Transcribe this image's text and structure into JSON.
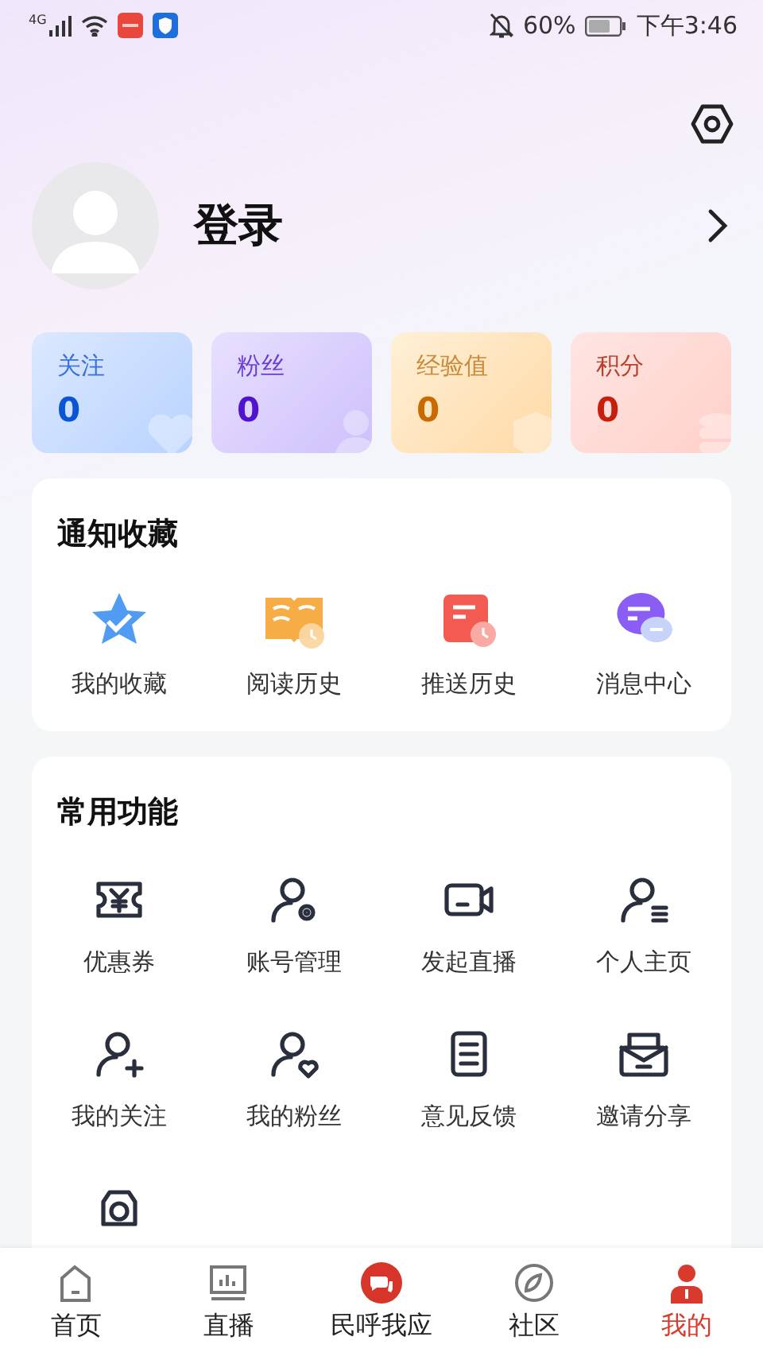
{
  "status_bar": {
    "network": "4G",
    "battery_percent": "60%",
    "time": "下午3:46"
  },
  "profile": {
    "name": "登录"
  },
  "stats": [
    {
      "label": "关注",
      "value": "0",
      "kind": "follow",
      "color": "#0a55d6"
    },
    {
      "label": "粉丝",
      "value": "0",
      "kind": "fans",
      "color": "#5014d0"
    },
    {
      "label": "经验值",
      "value": "0",
      "kind": "exp",
      "color": "#c86a00"
    },
    {
      "label": "积分",
      "value": "0",
      "kind": "points",
      "color": "#c81e0e"
    }
  ],
  "notifications": {
    "title": "通知收藏",
    "items": [
      {
        "label": "我的收藏"
      },
      {
        "label": "阅读历史"
      },
      {
        "label": "推送历史"
      },
      {
        "label": "消息中心"
      }
    ]
  },
  "functions": {
    "title": "常用功能",
    "items": [
      {
        "label": "优惠券"
      },
      {
        "label": "账号管理"
      },
      {
        "label": "发起直播"
      },
      {
        "label": "个人主页"
      },
      {
        "label": "我的关注"
      },
      {
        "label": "我的粉丝"
      },
      {
        "label": "意见反馈"
      },
      {
        "label": "邀请分享"
      },
      {
        "kind": "partial"
      }
    ]
  },
  "tab_bar": [
    {
      "label": "首页",
      "selected": false
    },
    {
      "label": "直播",
      "selected": false
    },
    {
      "label": "民呼我应",
      "selected": false
    },
    {
      "label": "社区",
      "selected": false
    },
    {
      "label": "我的",
      "selected": true
    }
  ]
}
